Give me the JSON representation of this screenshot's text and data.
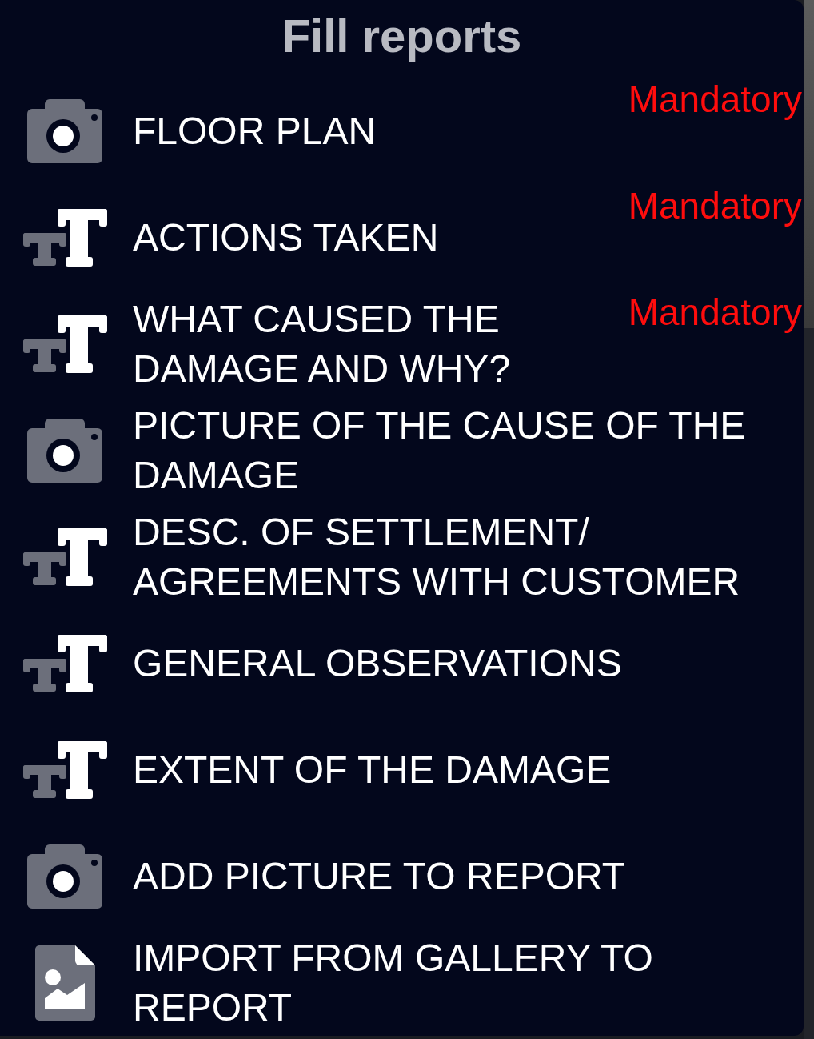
{
  "dialog": {
    "title": "Fill reports",
    "options": [
      {
        "kind": "camera",
        "label": "FLOOR PLAN",
        "tag": "Mandatory"
      },
      {
        "kind": "text",
        "label": "ACTIONS TAKEN",
        "tag": "Mandatory"
      },
      {
        "kind": "text",
        "label": "WHAT CAUSED THE DAMAGE AND WHY?",
        "tag": "Mandatory"
      },
      {
        "kind": "camera",
        "label": "PICTURE OF THE CAUSE OF THE DAMAGE"
      },
      {
        "kind": "text",
        "label": "DESC. OF SETTLEMENT/AGREEMENTS WITH CUSTOMER"
      },
      {
        "kind": "text",
        "label": "GENERAL OBSERVATIONS"
      },
      {
        "kind": "text",
        "label": "EXTENT OF THE DAMAGE"
      },
      {
        "kind": "camera",
        "label": "ADD PICTURE TO REPORT"
      },
      {
        "kind": "gallery",
        "label": "IMPORT FROM GALLERY TO REPORT"
      }
    ]
  }
}
